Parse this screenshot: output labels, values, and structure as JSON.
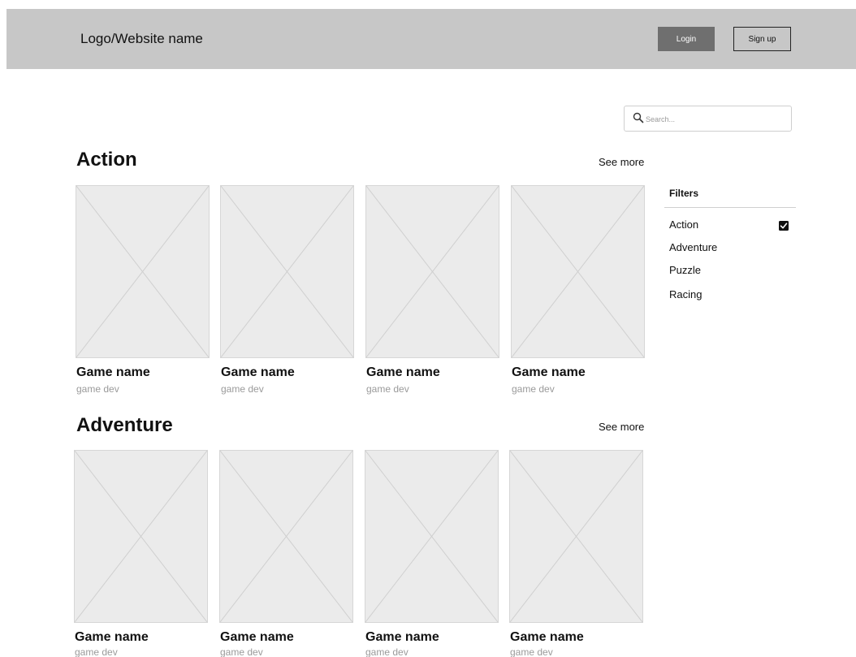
{
  "header": {
    "logo": "Logo/Website name",
    "login_label": "Login",
    "signup_label": "Sign up"
  },
  "search": {
    "placeholder": "Search...",
    "icon": "search-icon"
  },
  "sections": [
    {
      "title": "Action",
      "see_more": "See more",
      "games": [
        {
          "name": "Game name",
          "dev": "game dev"
        },
        {
          "name": "Game name",
          "dev": "game dev"
        },
        {
          "name": "Game name",
          "dev": "game dev"
        },
        {
          "name": "Game name",
          "dev": "game dev"
        }
      ]
    },
    {
      "title": "Adventure",
      "see_more": "See more",
      "games": [
        {
          "name": "Game name",
          "dev": "game dev"
        },
        {
          "name": "Game name",
          "dev": "game dev"
        },
        {
          "name": "Game name",
          "dev": "game dev"
        },
        {
          "name": "Game name",
          "dev": "game dev"
        }
      ]
    }
  ],
  "filters": {
    "title": "Filters",
    "items": [
      {
        "label": "Action",
        "checked": true
      },
      {
        "label": "Adventure",
        "checked": false
      },
      {
        "label": "Puzzle",
        "checked": false
      },
      {
        "label": "Racing",
        "checked": false
      }
    ]
  },
  "colors": {
    "header_bg": "#c7c7c7",
    "login_bg": "#6f6f6f",
    "placeholder_bg": "#ebebeb",
    "muted_text": "#9a9a9a"
  }
}
